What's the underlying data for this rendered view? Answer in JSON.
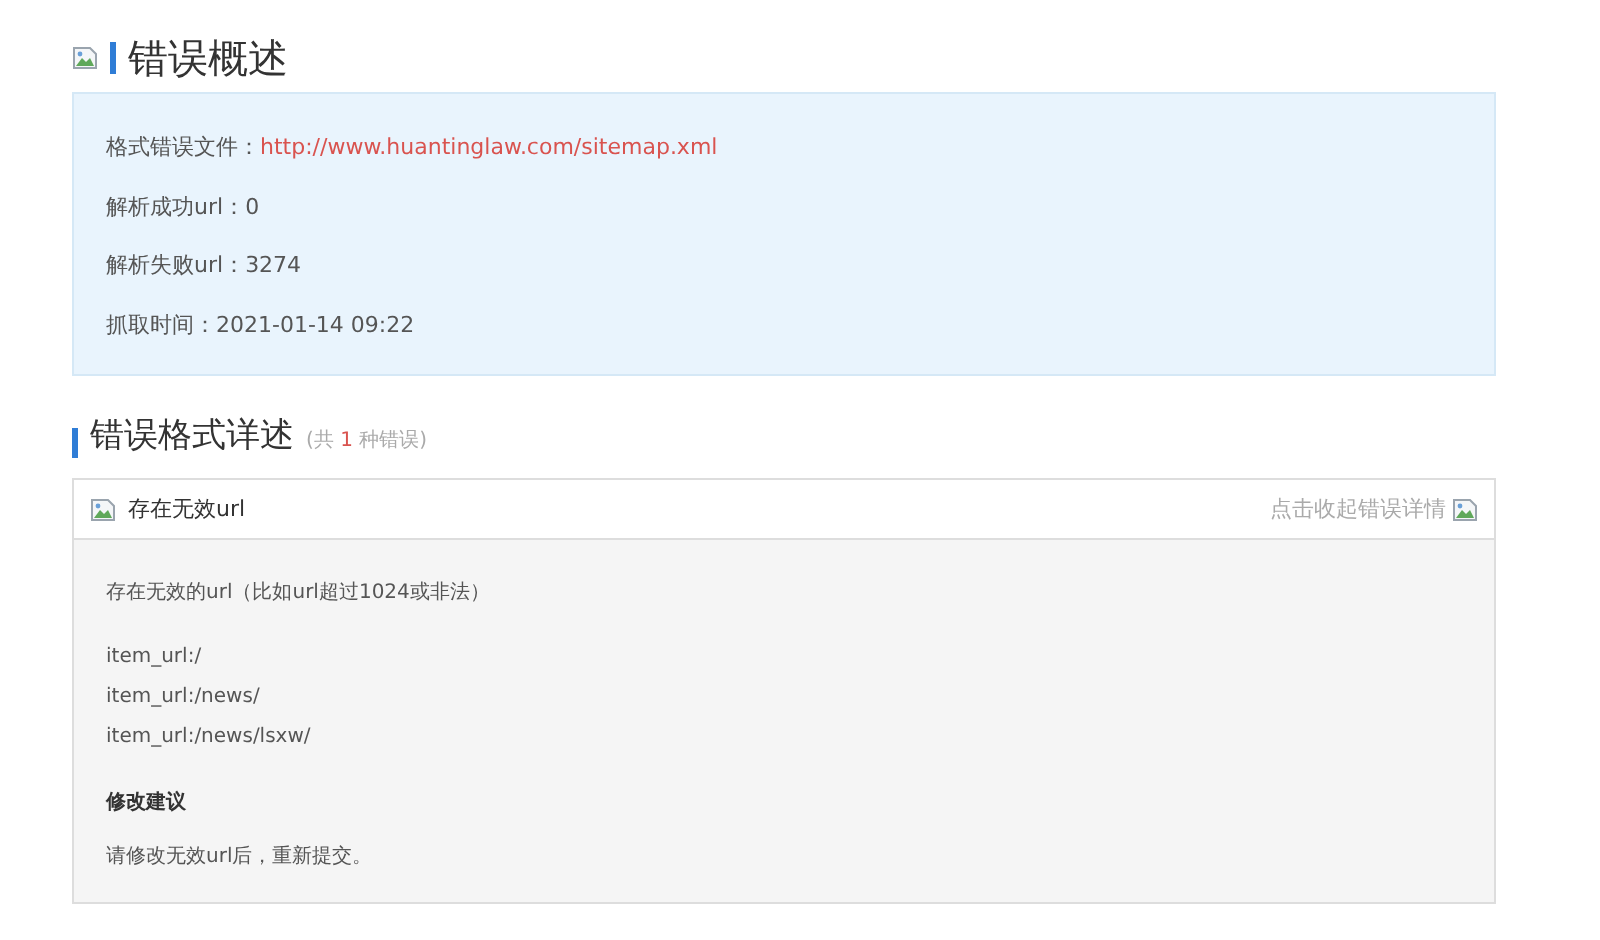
{
  "overview": {
    "title": "错误概述",
    "rows": [
      {
        "label": "格式错误文件：",
        "value": "http://www.huantinglaw.com/sitemap.xml",
        "kind": "link"
      },
      {
        "label": "解析成功url：",
        "value": "0",
        "kind": "text"
      },
      {
        "label": "解析失败url：",
        "value": "3274",
        "kind": "text"
      },
      {
        "label": "抓取时间：",
        "value": "2021-01-14 09:22",
        "kind": "text"
      }
    ]
  },
  "details": {
    "title": "错误格式详述",
    "summary": {
      "prefix": "(共",
      "count": "1",
      "suffix": "种错误)"
    },
    "errors": [
      {
        "name": "存在无效url",
        "toggle": "点击收起错误详情",
        "description": "存在无效的url（比如url超过1024或非法）",
        "items": [
          "item_url:/",
          "item_url:/news/",
          "item_url:/news/lsxw/"
        ],
        "advice_title": "修改建议",
        "advice": "请修改无效url后，重新提交。"
      }
    ]
  }
}
